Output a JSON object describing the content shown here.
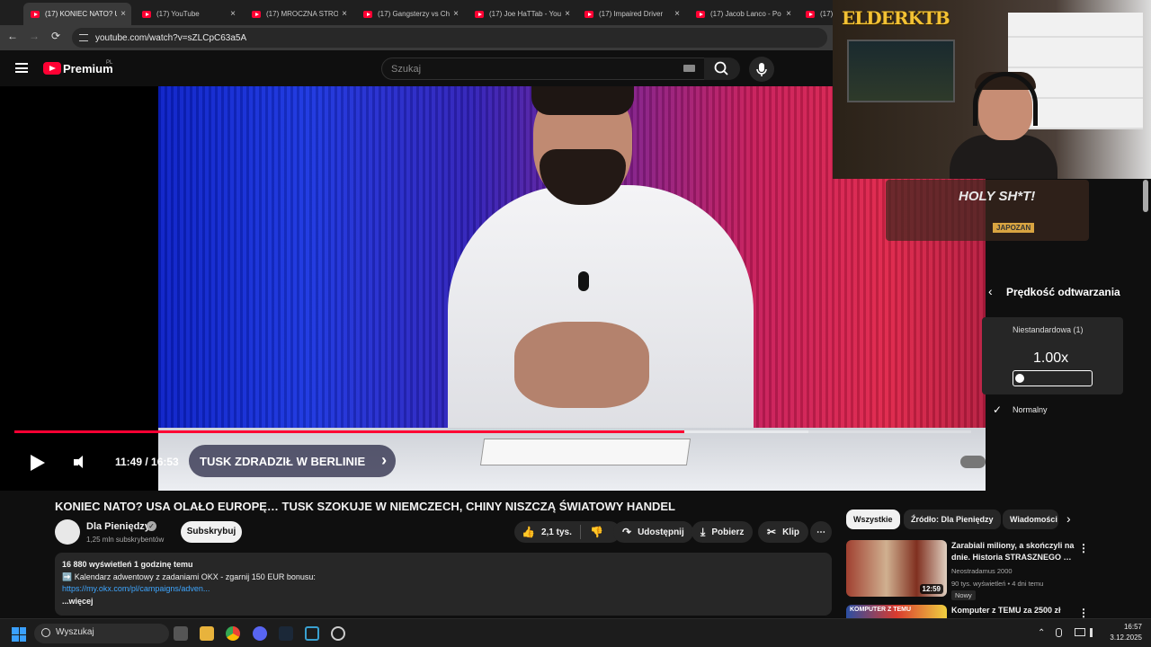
{
  "browser": {
    "tabs": [
      {
        "title": "(17) KONIEC NATO? U",
        "active": true
      },
      {
        "title": "(17) YouTube",
        "active": false
      },
      {
        "title": "(17) MROCZNA STRO",
        "active": false
      },
      {
        "title": "(17) Gangsterzy vs Ch",
        "active": false
      },
      {
        "title": "(17) Joe HaTTab - You",
        "active": false
      },
      {
        "title": "(17) Impaired Driver",
        "active": false
      },
      {
        "title": "(17) Jacob Lanco - Po",
        "active": false
      },
      {
        "title": "(17) Jaco",
        "active": false
      }
    ],
    "close_glyph": "×",
    "back_glyph": "←",
    "forward_glyph": "→",
    "reload_glyph": "⟳",
    "url": "youtube.com/watch?v=sZLCpC63a5A"
  },
  "masthead": {
    "brand": "Premium",
    "region": "PL",
    "search_placeholder": "Szukaj",
    "search_icon": "search-icon",
    "mic_icon": "mic-icon"
  },
  "player": {
    "current_time": "11:49",
    "duration": "16:53",
    "time_display": "11:49 / 16:53",
    "progress_fraction": 0.7,
    "buffer_fraction": 0.83,
    "chapter_title": "TUSK ZDRADZIŁ W BERLINIE",
    "hd_badge": "HD",
    "settings": {
      "back_glyph": "‹",
      "title": "Prędkość odtwarzania",
      "custom_label": "Niestandardowa (1)",
      "custom_value": "1.00x",
      "slider_fraction": 0.0,
      "check_glyph": "✓",
      "normal_label": "Normalny"
    }
  },
  "overlay": {
    "webcam_logo": "ELDERKTB",
    "promo_text": "HOLY SH*T!",
    "promo_sub": "JAPOZAN"
  },
  "video": {
    "title": "KONIEC NATO? USA OLAŁO EUROPĘ… TUSK SZOKUJE W NIEMCZECH, CHINY NISZCZĄ ŚWIATOWY HANDEL",
    "channel": "Dla Pieniędzy",
    "verified_glyph": "✓",
    "subscribers": "1,25 mln subskrybentów",
    "subscribe_label": "Subskrybuj",
    "likes": "2,1 tys.",
    "share_label": "Udostępnij",
    "download_label": "Pobierz",
    "clip_label": "Klip",
    "more_glyph": "⋯",
    "like_glyph": "👍",
    "dislike_glyph": "👎",
    "share_glyph": "↷",
    "download_glyph": "⤓",
    "clip_glyph": "✂",
    "description": {
      "meta": "16 880 wyświetleń  1 godzinę temu",
      "line1": "➡️ Kalendarz adwentowy z zadaniami OKX - zgarnij 150 EUR bonusu:",
      "link": "https://my.okx.com/pl/campaigns/adven...",
      "more": "...więcej"
    }
  },
  "related": {
    "chips": [
      "Wszystkie",
      "Źródło: Dla Pieniędzy",
      "Wiadomości"
    ],
    "next_glyph": "›",
    "kebab_glyph": "⋮",
    "items": [
      {
        "title": "Zarabiali miliony, a skończyli na dnie. Historia STRASZNEGO …",
        "channel": "Neostradamus 2000",
        "meta": "90 tys. wyświetleń  •  4 dni temu",
        "duration": "12:59",
        "badge": "Nowy"
      },
      {
        "title": "Komputer z TEMU za 2500 zł",
        "thumb_text": "KOMPUTER Z TEMU"
      }
    ]
  },
  "taskbar": {
    "search_label": "Wyszukaj",
    "time": "16:57",
    "date": "3.12.2025",
    "tray_up_glyph": "⌃"
  },
  "colors": {
    "youtube_red": "#ff0033",
    "link_blue": "#3ea6ff",
    "background": "#0f0f0f",
    "chip_bg": "#272727"
  }
}
